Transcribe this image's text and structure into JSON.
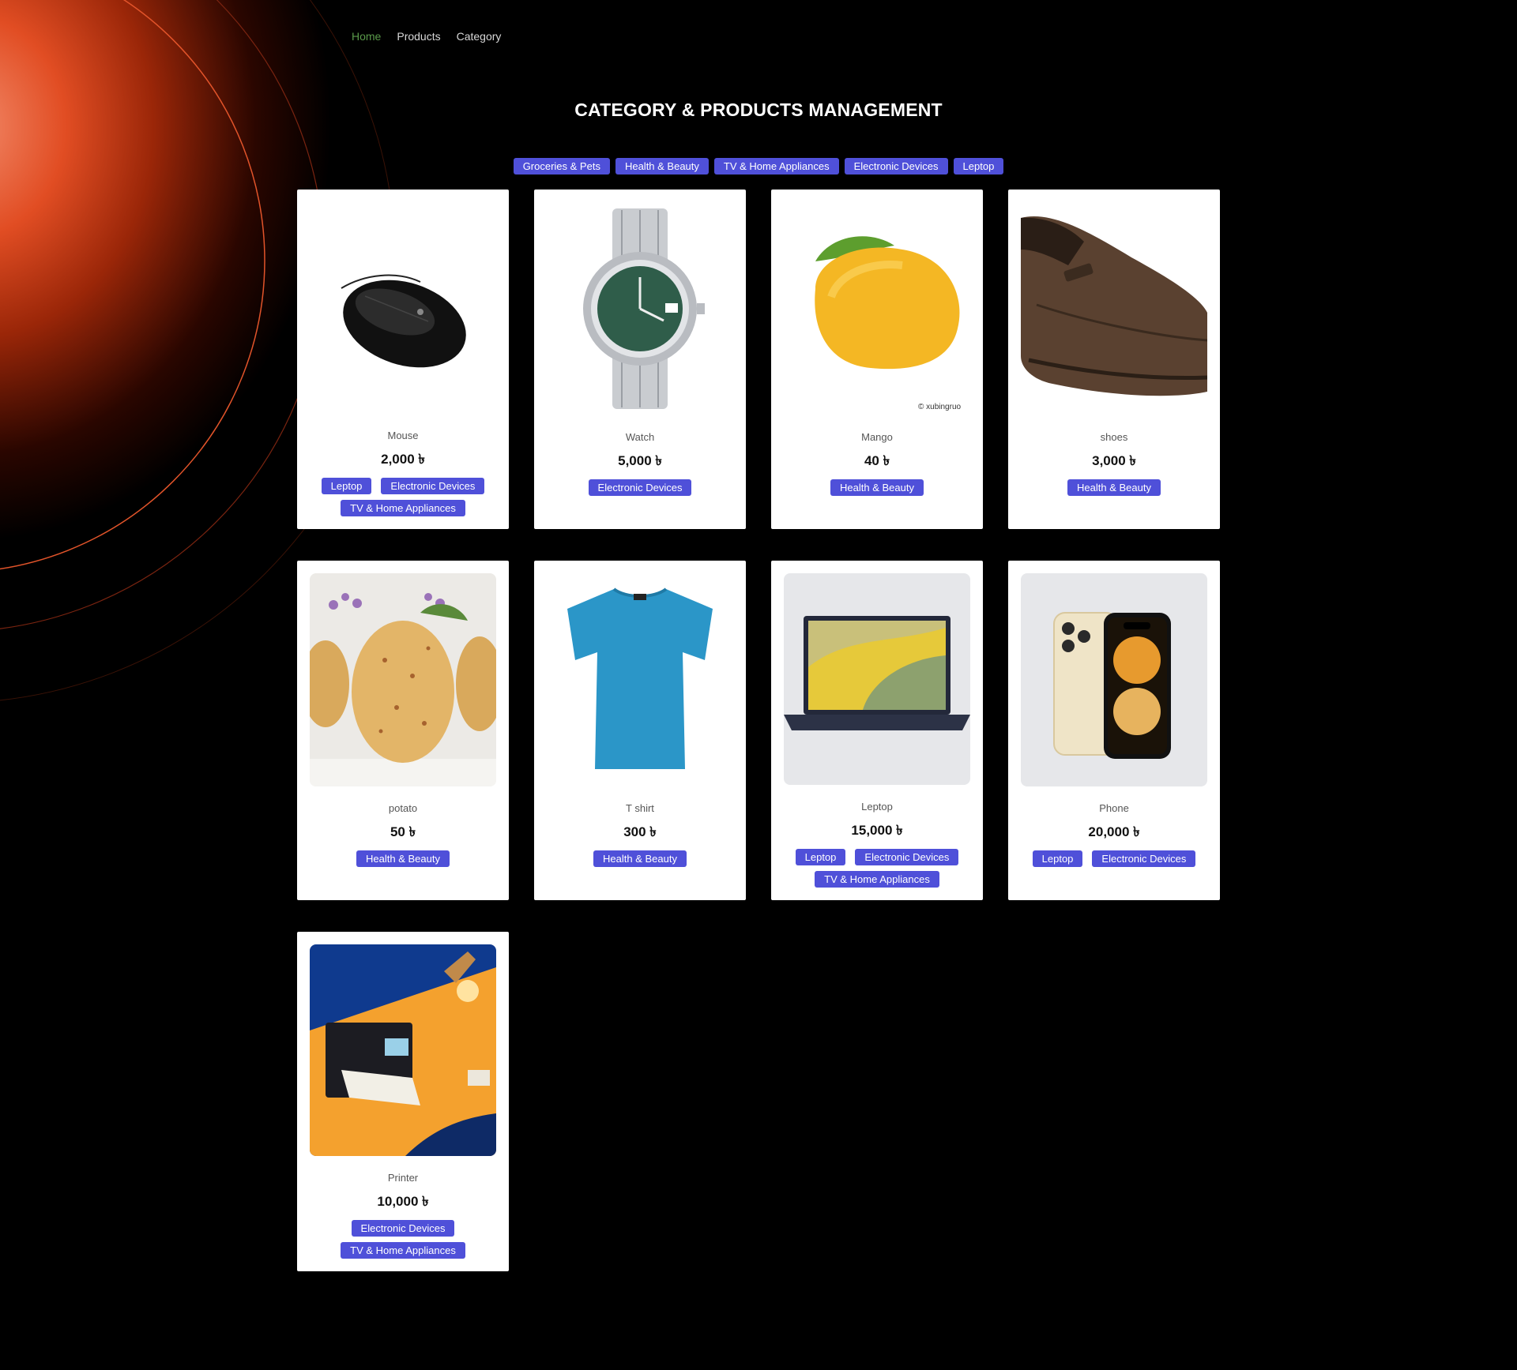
{
  "nav": {
    "items": [
      {
        "label": "Home",
        "active": true
      },
      {
        "label": "Products",
        "active": false
      },
      {
        "label": "Category",
        "active": false
      }
    ]
  },
  "page": {
    "title": "CATEGORY & PRODUCTS MANAGEMENT"
  },
  "filters": [
    "Groceries & Pets",
    "Health & Beauty",
    "TV & Home Appliances",
    "Electronic Devices",
    "Leptop"
  ],
  "currency_symbol": "৳",
  "products": [
    {
      "name": "Mouse",
      "price": "2,000 ৳",
      "image": "mouse",
      "categories": [
        "Leptop",
        "Electronic Devices",
        "TV & Home Appliances"
      ]
    },
    {
      "name": "Watch",
      "price": "5,000 ৳",
      "image": "watch",
      "categories": [
        "Electronic Devices"
      ]
    },
    {
      "name": "Mango",
      "price": "40 ৳",
      "image": "mango",
      "image_caption": "© xubingruo",
      "categories": [
        "Health & Beauty"
      ]
    },
    {
      "name": "shoes",
      "price": "3,000 ৳",
      "image": "shoe",
      "categories": [
        "Health & Beauty"
      ]
    },
    {
      "name": "potato",
      "price": "50 ৳",
      "image": "potato",
      "categories": [
        "Health & Beauty"
      ]
    },
    {
      "name": "T shirt",
      "price": "300 ৳",
      "image": "tshirt",
      "categories": [
        "Health & Beauty"
      ]
    },
    {
      "name": "Leptop",
      "price": "15,000 ৳",
      "image": "laptop",
      "categories": [
        "Leptop",
        "Electronic Devices",
        "TV & Home Appliances"
      ]
    },
    {
      "name": "Phone",
      "price": "20,000 ৳",
      "image": "phone",
      "categories": [
        "Leptop",
        "Electronic Devices"
      ]
    },
    {
      "name": "Printer",
      "price": "10,000 ৳",
      "image": "printer",
      "categories": [
        "Electronic Devices",
        "TV & Home Appliances"
      ]
    }
  ],
  "colors": {
    "background": "#000000",
    "chip": "#4f50d9",
    "nav_active": "#5a9a4a",
    "glow": "#e14d23"
  }
}
